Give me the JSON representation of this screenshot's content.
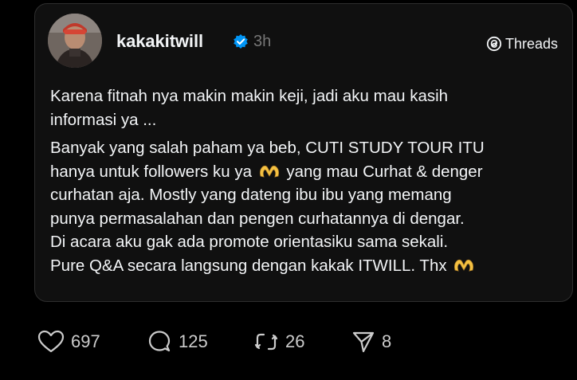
{
  "post": {
    "username": "kakakitwill",
    "verified": true,
    "timestamp": "3h",
    "brand_label": "Threads",
    "brand_icon": "threads-logo-icon",
    "paragraphs": [
      "Karena fitnah nya makin makin keji, jadi aku mau kasih\ninformasi ya ...",
      "Banyak yang salah paham ya beb, CUTI STUDY TOUR ITU\nhanya untuk followers ku ya ",
      " yang mau Curhat & denger\ncurhatan aja. Mostly yang dateng ibu ibu yang memang\npunya permasalahan dan pengen curhatannya di dengar.\nDi acara aku gak ada promote orientasiku sama sekali.\nPure Q&A secara langsung dengan kakak ITWILL. Thx "
    ],
    "emoji": "heart-hands-emoji"
  },
  "actions": {
    "likes": "697",
    "replies": "125",
    "reposts": "26",
    "shares": "8"
  },
  "colors": {
    "background": "#000000",
    "card": "#101010",
    "text": "#f3f5f7",
    "muted": "#777777",
    "verified": "#0095f6",
    "emoji": "#f5c242"
  }
}
